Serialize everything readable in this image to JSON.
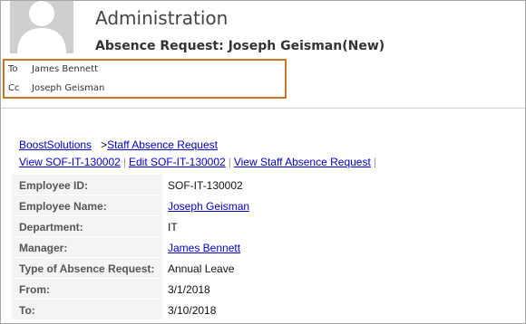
{
  "header": {
    "app_title": "Administration",
    "subject": "Absence Request: Joseph Geisman(New)"
  },
  "recipients": {
    "to_label": "To",
    "to_value": "James Bennett",
    "cc_label": "Cc",
    "cc_value": "Joseph Geisman"
  },
  "breadcrumb": {
    "site": "BoostSolutions",
    "separator": ">",
    "list": "Staff Absence Request"
  },
  "actions": {
    "view_item": "View SOF-IT-130002",
    "edit_item": "Edit SOF-IT-130002",
    "view_list": "View Staff Absence Request"
  },
  "details": {
    "employee_id_label": "Employee ID:",
    "employee_id": "SOF-IT-130002",
    "employee_name_label": "Employee Name:",
    "employee_name": "Joseph Geisman",
    "department_label": "Department:",
    "department": "IT",
    "manager_label": "Manager:",
    "manager": "James Bennett",
    "type_label": "Type of Absence Request:",
    "type": "Annual Leave",
    "from_label": "From:",
    "from": "3/1/2018",
    "to_label": "To:",
    "to": "3/10/2018"
  },
  "colors": {
    "highlight_border": "#c87628",
    "link": "#0000cc"
  }
}
